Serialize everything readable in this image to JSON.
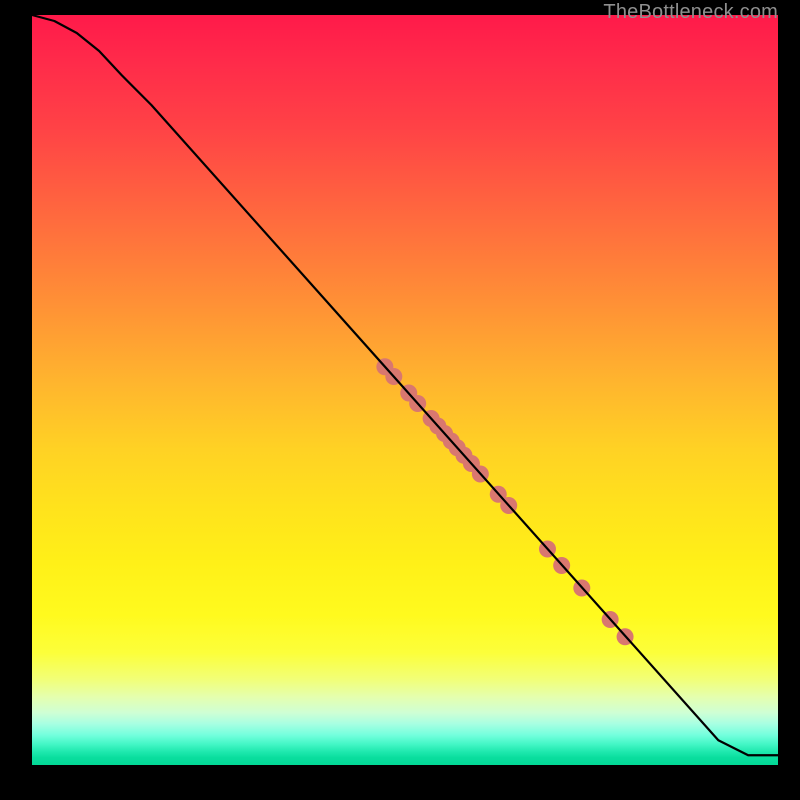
{
  "watermark": "TheBottleneck.com",
  "colors": {
    "background": "#000000",
    "curve": "#000000",
    "marker_fill": "#d9776f",
    "marker_stroke": "#a84c47"
  },
  "chart_data": {
    "type": "line",
    "title": "",
    "xlabel": "",
    "ylabel": "",
    "xlim": [
      0,
      100
    ],
    "ylim": [
      0,
      100
    ],
    "grid": false,
    "series": [
      {
        "name": "curve",
        "x": [
          0,
          3,
          6,
          9,
          12,
          16,
          92,
          96,
          100
        ],
        "y": [
          100,
          99.2,
          97.6,
          95.2,
          92.0,
          88.0,
          3.3,
          1.3,
          1.3
        ]
      }
    ],
    "markers": {
      "name": "points-on-curve",
      "xy": [
        [
          47.3,
          53.1
        ],
        [
          48.5,
          51.8
        ],
        [
          50.5,
          49.6
        ],
        [
          51.7,
          48.2
        ],
        [
          53.5,
          46.2
        ],
        [
          54.4,
          45.2
        ],
        [
          55.3,
          44.2
        ],
        [
          56.2,
          43.2
        ],
        [
          57.0,
          42.3
        ],
        [
          57.9,
          41.3
        ],
        [
          58.9,
          40.2
        ],
        [
          60.1,
          38.8
        ],
        [
          62.5,
          36.1
        ],
        [
          63.9,
          34.6
        ],
        [
          69.1,
          28.8
        ],
        [
          71.0,
          26.6
        ],
        [
          73.7,
          23.6
        ],
        [
          77.5,
          19.4
        ],
        [
          79.5,
          17.1
        ]
      ],
      "radius_px": 8.5
    }
  }
}
